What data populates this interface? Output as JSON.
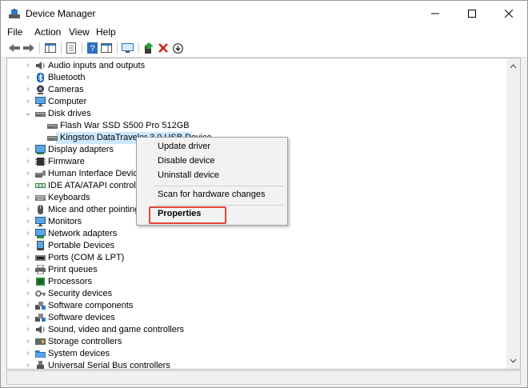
{
  "window": {
    "title": "Device Manager"
  },
  "menu": [
    "File",
    "Action",
    "View",
    "Help"
  ],
  "toolbar": [
    "back-icon",
    "forward-icon",
    "properties-icon",
    "help-icon",
    "update-driver-icon",
    "scan-icon",
    "enable-device-icon",
    "uninstall-icon",
    "download-icon"
  ],
  "tree": [
    {
      "label": "Audio inputs and outputs",
      "chev": "›",
      "icon": "speaker-icon"
    },
    {
      "label": "Bluetooth",
      "chev": "›",
      "icon": "bluetooth-icon"
    },
    {
      "label": "Cameras",
      "chev": "›",
      "icon": "camera-icon"
    },
    {
      "label": "Computer",
      "chev": "›",
      "icon": "monitor-icon"
    },
    {
      "label": "Disk drives",
      "chev": "⌄",
      "icon": "disk-icon"
    },
    {
      "label": "Flash War SSD S500 Pro 512GB",
      "chev": "",
      "icon": "disk-icon",
      "child": true
    },
    {
      "label": "Kingston DataTraveler 3.0 USB Device",
      "chev": "",
      "icon": "disk-icon",
      "child": true,
      "selected": true
    },
    {
      "label": "Display adapters",
      "chev": "›",
      "icon": "display-icon"
    },
    {
      "label": "Firmware",
      "chev": "›",
      "icon": "chip-icon"
    },
    {
      "label": "Human Interface Devices",
      "chev": "›",
      "icon": "hid-icon"
    },
    {
      "label": "IDE ATA/ATAPI controllers",
      "chev": "›",
      "icon": "controller-icon"
    },
    {
      "label": "Keyboards",
      "chev": "›",
      "icon": "keyboard-icon"
    },
    {
      "label": "Mice and other pointing devices",
      "chev": "›",
      "icon": "mouse-icon"
    },
    {
      "label": "Monitors",
      "chev": "›",
      "icon": "monitor-icon"
    },
    {
      "label": "Network adapters",
      "chev": "›",
      "icon": "network-icon"
    },
    {
      "label": "Portable Devices",
      "chev": "›",
      "icon": "portable-icon"
    },
    {
      "label": "Ports (COM & LPT)",
      "chev": "›",
      "icon": "port-icon"
    },
    {
      "label": "Print queues",
      "chev": "›",
      "icon": "printer-icon"
    },
    {
      "label": "Processors",
      "chev": "›",
      "icon": "cpu-icon"
    },
    {
      "label": "Security devices",
      "chev": "›",
      "icon": "key-icon"
    },
    {
      "label": "Software components",
      "chev": "›",
      "icon": "component-icon"
    },
    {
      "label": "Software devices",
      "chev": "›",
      "icon": "component-icon"
    },
    {
      "label": "Sound, video and game controllers",
      "chev": "›",
      "icon": "speaker-icon"
    },
    {
      "label": "Storage controllers",
      "chev": "›",
      "icon": "storage-icon"
    },
    {
      "label": "System devices",
      "chev": "›",
      "icon": "folder-icon"
    },
    {
      "label": "Universal Serial Bus controllers",
      "chev": "›",
      "icon": "usb-icon"
    }
  ],
  "context_menu": {
    "items": [
      "Update driver",
      "Disable device",
      "Uninstall device",
      "Scan for hardware changes",
      "Properties"
    ]
  },
  "colors": {
    "selection": "#cce8ff",
    "highlight": "#e0453a"
  }
}
